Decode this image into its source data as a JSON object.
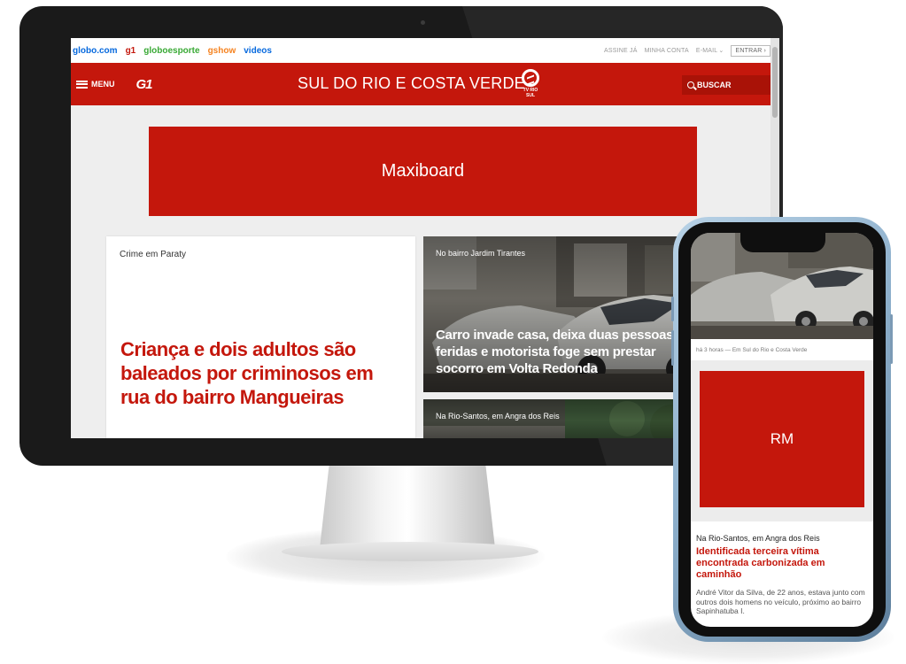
{
  "globobar": {
    "links": [
      {
        "label": "globo.com",
        "color": "#0669de"
      },
      {
        "label": "g1",
        "color": "#c4170c"
      },
      {
        "label": "globoesporte",
        "color": "#39a935"
      },
      {
        "label": "gshow",
        "color": "#f5821f"
      },
      {
        "label": "videos",
        "color": "#0669de"
      }
    ],
    "assine": "ASSINE JÁ",
    "minha_conta": "MINHA CONTA",
    "email": "E-MAIL",
    "entrar": "ENTRAR"
  },
  "header": {
    "menu_label": "MENU",
    "logo": "G1",
    "region": "SUL DO RIO E COSTA VERDE",
    "tv_name": "TV RIO SUL",
    "search_label": "BUSCAR"
  },
  "ads": {
    "maxiboard": "Maxiboard",
    "rm": "RM"
  },
  "feed": {
    "lead": {
      "kicker": "Crime em Paraty",
      "headline": "Criança e dois adultos são baleados por criminosos em rua do bairro Mangueiras"
    },
    "photo_story": {
      "kicker": "No bairro Jardim Tirantes",
      "headline": "Carro invade casa, deixa duas pessoas feridas e motorista foge sem prestar socorro em Volta Redonda"
    },
    "photo_story_2": {
      "kicker": "Na Rio-Santos, em Angra dos Reis"
    }
  },
  "mobile": {
    "caption": "há 3 horas — Em Sul do Rio e Costa Verde",
    "kicker": "Na Rio-Santos, em Angra dos Reis",
    "headline": "Identificada terceira vítima encontrada carbonizada em caminhão",
    "body": "André Vitor da Silva, de 22 anos, estava junto com outros dois homens no veículo, próximo ao bairro Sapinhatuba I."
  },
  "colors": {
    "brand_red": "#c4170c",
    "phone_frame": "#8eb0cc"
  }
}
